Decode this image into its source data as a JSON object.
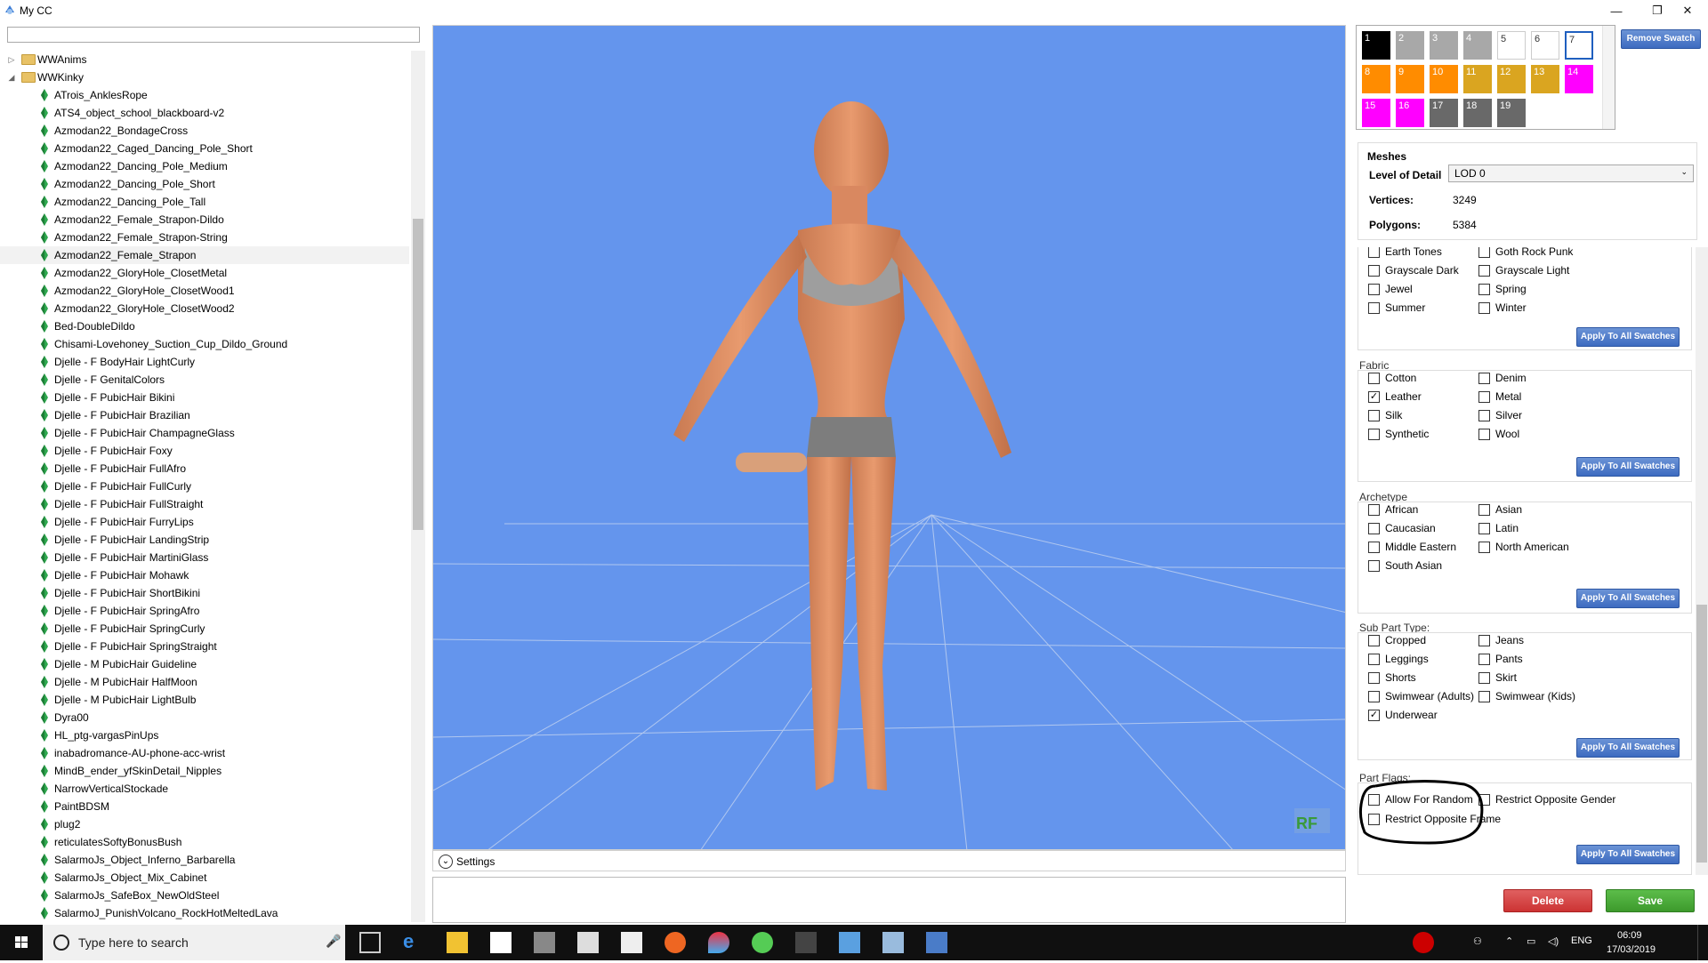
{
  "window": {
    "title": "My CC",
    "minimize": "—",
    "maximize": "❐",
    "close": "✕"
  },
  "tree": {
    "folders": [
      {
        "label": "WWAnims",
        "expanded": false
      },
      {
        "label": "WWKinky",
        "expanded": true
      }
    ],
    "items": [
      "ATrois_AnklesRope",
      "ATS4_object_school_blackboard-v2",
      "Azmodan22_BondageCross",
      "Azmodan22_Caged_Dancing_Pole_Short",
      "Azmodan22_Dancing_Pole_Medium",
      "Azmodan22_Dancing_Pole_Short",
      "Azmodan22_Dancing_Pole_Tall",
      "Azmodan22_Female_Strapon-Dildo",
      "Azmodan22_Female_Strapon-String",
      "Azmodan22_Female_Strapon",
      "Azmodan22_GloryHole_ClosetMetal",
      "Azmodan22_GloryHole_ClosetWood1",
      "Azmodan22_GloryHole_ClosetWood2",
      "Bed-DoubleDildo",
      "Chisami-Lovehoney_Suction_Cup_Dildo_Ground",
      "Djelle - F BodyHair LightCurly",
      "Djelle - F GenitalColors",
      "Djelle - F PubicHair Bikini",
      "Djelle - F PubicHair Brazilian",
      "Djelle - F PubicHair ChampagneGlass",
      "Djelle - F PubicHair Foxy",
      "Djelle - F PubicHair FullAfro",
      "Djelle - F PubicHair FullCurly",
      "Djelle - F PubicHair FullStraight",
      "Djelle - F PubicHair FurryLips",
      "Djelle - F PubicHair LandingStrip",
      "Djelle - F PubicHair MartiniGlass",
      "Djelle - F PubicHair Mohawk",
      "Djelle - F PubicHair ShortBikini",
      "Djelle - F PubicHair SpringAfro",
      "Djelle - F PubicHair SpringCurly",
      "Djelle - F PubicHair SpringStraight",
      "Djelle - M PubicHair Guideline",
      "Djelle - M PubicHair HalfMoon",
      "Djelle - M PubicHair LightBulb",
      "Dyra00",
      "HL_ptg-vargasPinUps",
      "inabadromance-AU-phone-acc-wrist",
      "MindB_ender_yfSkinDetail_Nipples",
      "NarrowVerticalStockade",
      "PaintBDSM",
      "plug2",
      "reticulatesSoftyBonusBush",
      "SalarmoJs_Object_Inferno_Barbarella",
      "SalarmoJs_Object_Mix_Cabinet",
      "SalarmoJs_SafeBox_NewOldSteel",
      "SalarmoJ_PunishVolcano_RockHotMeltedLava"
    ],
    "selected_index": 9
  },
  "viewport": {
    "settings_label": "Settings",
    "logo": "RF",
    "model_icon": "sim-model-figure"
  },
  "swatches": {
    "items": [
      {
        "n": "1",
        "color": "#000000"
      },
      {
        "n": "2",
        "color": "#a8a8a8"
      },
      {
        "n": "3",
        "color": "#a8a8a8"
      },
      {
        "n": "4",
        "color": "#a8a8a8"
      },
      {
        "n": "5",
        "color": "#ffffff"
      },
      {
        "n": "6",
        "color": "#ffffff"
      },
      {
        "n": "7",
        "color": "#ffffff"
      },
      {
        "n": "8",
        "color": "#ff8c00"
      },
      {
        "n": "9",
        "color": "#ff8c00"
      },
      {
        "n": "10",
        "color": "#ff8c00"
      },
      {
        "n": "11",
        "color": "#daa520"
      },
      {
        "n": "12",
        "color": "#daa520"
      },
      {
        "n": "13",
        "color": "#daa520"
      },
      {
        "n": "14",
        "color": "#ff00ff"
      },
      {
        "n": "15",
        "color": "#ff00ff"
      },
      {
        "n": "16",
        "color": "#ff00ff"
      },
      {
        "n": "17",
        "color": "#696969"
      },
      {
        "n": "18",
        "color": "#696969"
      },
      {
        "n": "19",
        "color": "#696969"
      }
    ],
    "selected": "7",
    "remove_label": "Remove Swatch"
  },
  "meshes": {
    "heading": "Meshes",
    "lod_label": "Level of Detail",
    "lod_value": "LOD 0",
    "vertices_label": "Vertices:",
    "vertices": "3249",
    "polygons_label": "Polygons:",
    "polygons": "5384"
  },
  "apply_label": "Apply To All Swatches",
  "colors_section": {
    "items": [
      {
        "label": "Earth Tones",
        "checked": false
      },
      {
        "label": "Goth Rock Punk",
        "checked": false
      },
      {
        "label": "Grayscale Dark",
        "checked": false
      },
      {
        "label": "Grayscale Light",
        "checked": false
      },
      {
        "label": "Jewel",
        "checked": false
      },
      {
        "label": "Spring",
        "checked": false
      },
      {
        "label": "Summer",
        "checked": false
      },
      {
        "label": "Winter",
        "checked": false
      }
    ]
  },
  "fabric": {
    "title": "Fabric",
    "items": [
      {
        "label": "Cotton",
        "checked": false
      },
      {
        "label": "Denim",
        "checked": false
      },
      {
        "label": "Leather",
        "checked": true
      },
      {
        "label": "Metal",
        "checked": false
      },
      {
        "label": "Silk",
        "checked": false
      },
      {
        "label": "Silver",
        "checked": false
      },
      {
        "label": "Synthetic",
        "checked": false
      },
      {
        "label": "Wool",
        "checked": false
      }
    ]
  },
  "archetype": {
    "title": "Archetype",
    "items": [
      {
        "label": "African",
        "checked": false
      },
      {
        "label": "Asian",
        "checked": false
      },
      {
        "label": "Caucasian",
        "checked": false
      },
      {
        "label": "Latin",
        "checked": false
      },
      {
        "label": "Middle Eastern",
        "checked": false
      },
      {
        "label": "North American",
        "checked": false
      },
      {
        "label": "South Asian",
        "checked": false
      }
    ]
  },
  "subpart": {
    "title": "Sub Part Type:",
    "items": [
      {
        "label": "Cropped",
        "checked": false
      },
      {
        "label": "Jeans",
        "checked": false
      },
      {
        "label": "Leggings",
        "checked": false
      },
      {
        "label": "Pants",
        "checked": false
      },
      {
        "label": "Shorts",
        "checked": false
      },
      {
        "label": "Skirt",
        "checked": false
      },
      {
        "label": "Swimwear (Adults)",
        "checked": false
      },
      {
        "label": "Swimwear (Kids)",
        "checked": false
      },
      {
        "label": "Underwear",
        "checked": true
      }
    ]
  },
  "partflags": {
    "title": "Part Flags:",
    "items": [
      {
        "label": "Allow For Random",
        "checked": false
      },
      {
        "label": "Restrict Opposite Gender",
        "checked": false
      },
      {
        "label": "Restrict Opposite Frame",
        "checked": false
      }
    ]
  },
  "actions": {
    "delete": "Delete",
    "save": "Save"
  },
  "taskbar": {
    "search_placeholder": "Type here to search",
    "lang": "ENG",
    "time": "06:09",
    "date": "17/03/2019"
  }
}
